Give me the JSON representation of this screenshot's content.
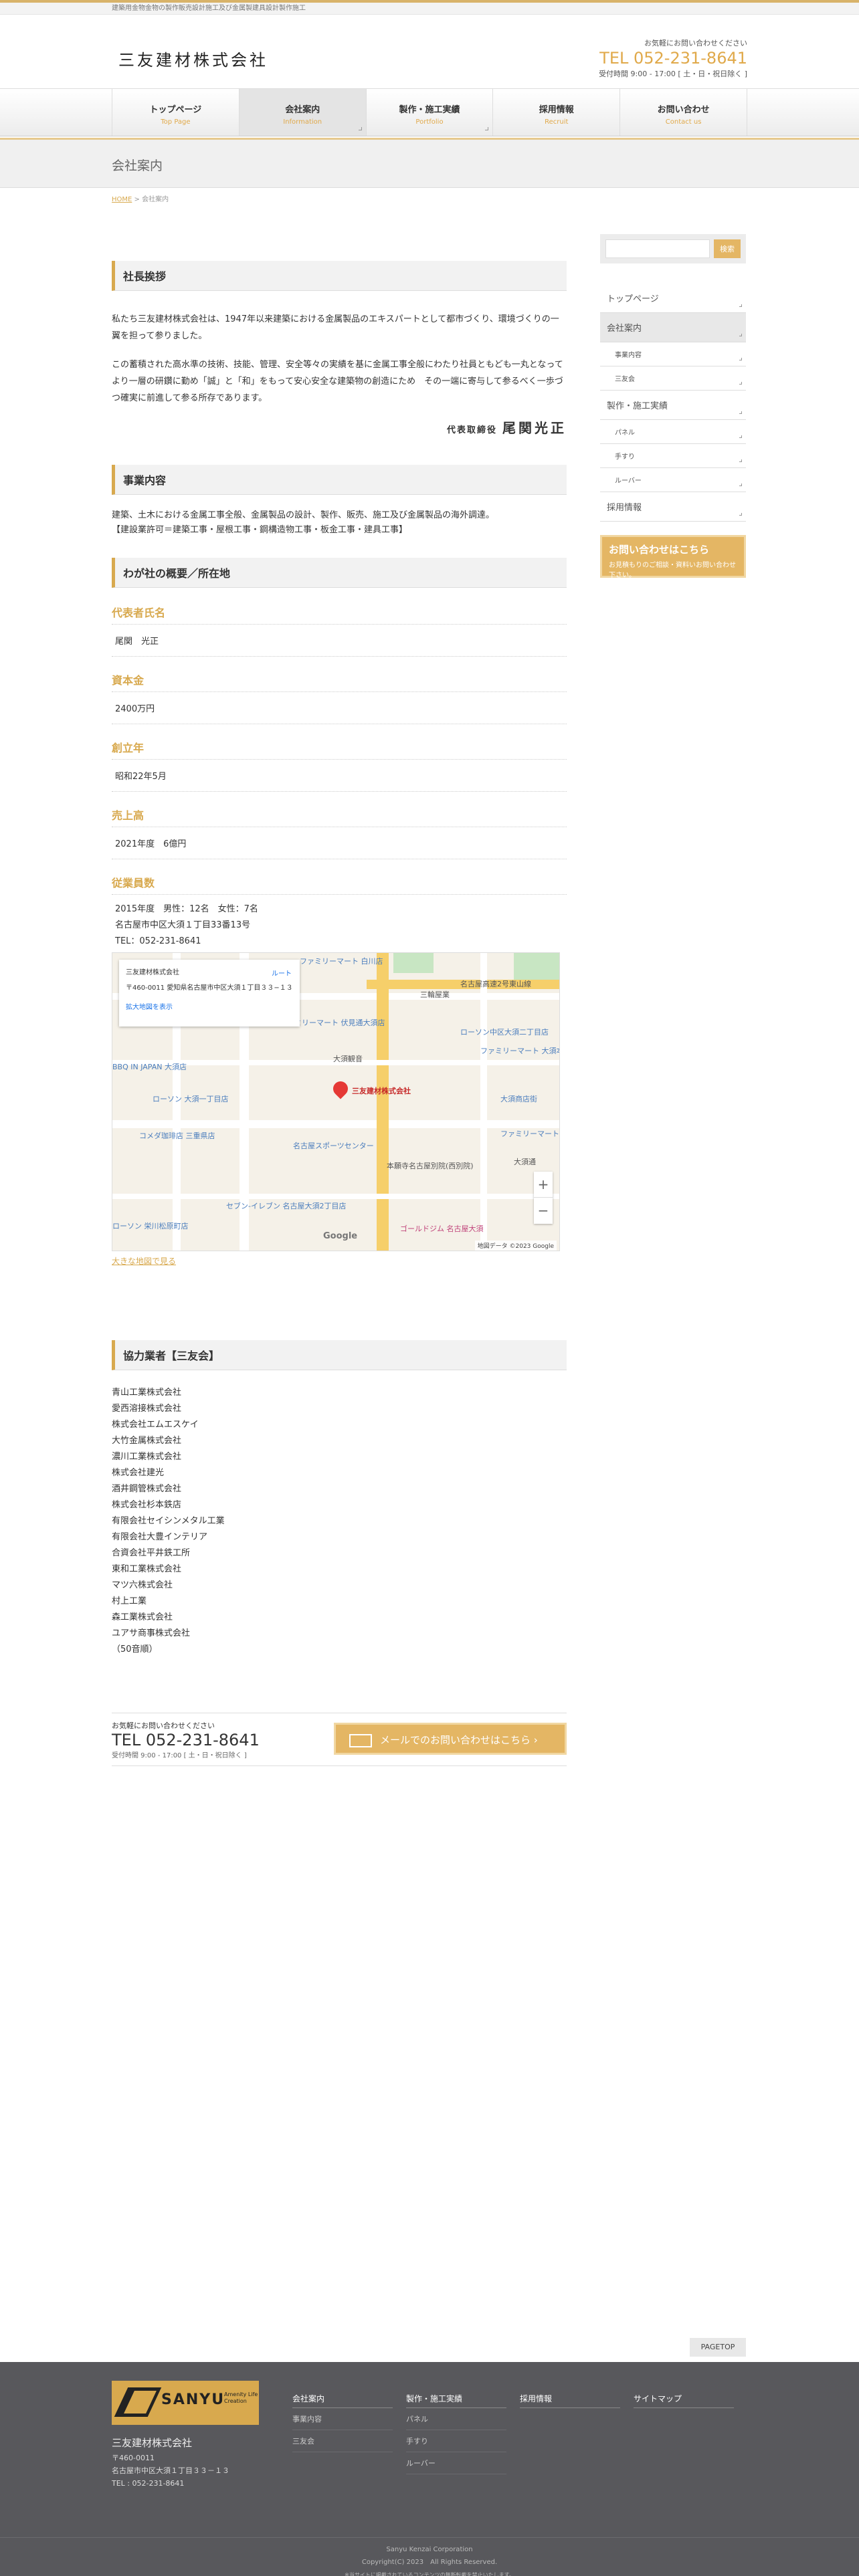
{
  "topbar": {
    "text": "建築用金物金物の製作販売設計施工及び金属製建具設計製作施工"
  },
  "header": {
    "logo": "三友建材株式会社",
    "contact_label": "お気軽にお問い合わせください",
    "tel": "TEL 052-231-8641",
    "hours": "受付時間 9:00 - 17:00 [ 土・日・祝日除く ]"
  },
  "nav": [
    {
      "jp": "トップページ",
      "en": "Top Page"
    },
    {
      "jp": "会社案内",
      "en": "Information"
    },
    {
      "jp": "製作・施工実績",
      "en": "Portfolio"
    },
    {
      "jp": "採用情報",
      "en": "Recruit"
    },
    {
      "jp": "お問い合わせ",
      "en": "Contact us"
    }
  ],
  "page_title": "会社案内",
  "breadcrumb": {
    "home": "HOME",
    "sep": " > ",
    "current": "会社案内"
  },
  "greeting": {
    "heading": "社長挨拶",
    "p1": "私たち三友建材株式会社は、1947年以来建築における金属製品のエキスパートとして都市づくり、環境づくりの一翼を担って参りました。",
    "p2": "この蓄積された高水準の技術、技能、管理、安全等々の実績を基に金属工事全般にわたり社員ともども一丸となってより一層の研鑽に勤め「誠」と「和」をもって安心安全な建築物の創造にため　その一端に寄与して参るべく一歩づつ確実に前進して参る所存であります。",
    "sign_title": "代表取締役",
    "sign_name": "尾関光正"
  },
  "business": {
    "heading": "事業内容",
    "line1": "建築、土木における金属工事全般、金属製品の設計、製作、販売、施工及び金属製品の海外調達。",
    "line2": "【建設業許可＝建築工事・屋根工事・鋼構造物工事・板金工事・建具工事】"
  },
  "overview": {
    "heading": "わが社の概要／所在地",
    "rows": [
      {
        "label": "代表者氏名",
        "value": "尾関　光正"
      },
      {
        "label": "資本金",
        "value": "2400万円"
      },
      {
        "label": "創立年",
        "value": "昭和22年5月"
      },
      {
        "label": "売上高",
        "value": "2021年度　6億円"
      },
      {
        "label": "従業員数",
        "value": ""
      }
    ],
    "employees": "2015年度　男性：12名　女性：7名",
    "address": "名古屋市中区大須１丁目33番13号",
    "tel": "TEL：052-231-8641",
    "biglink": "大きな地図で見る"
  },
  "map": {
    "card_title": "三友建材株式会社",
    "card_addr": "〒460-0011 愛知県名古屋市中区大須１丁目３３−１３",
    "card_link": "拡大地図を表示",
    "card_route": "ルート",
    "marker": "三友建材株式会社",
    "labels": {
      "a": "ファミリーマート 白川店",
      "b": "名古屋高速2号東山線",
      "c": "三輪屋業",
      "d": "ローソン中区大須二丁目店",
      "e": "ファミリーマート 伏見通大須店",
      "f": "大須観音",
      "g": "ファミリーマート 大須本通店",
      "h": "大須商店街",
      "i": "BBQ IN JAPAN 大須店",
      "j": "ローソン 大須一丁目店",
      "k": "コメダ珈琲店 三重県店",
      "l": "名古屋スポーツセンター",
      "m": "ファミリーマート",
      "n": "セブン-イレブン 名古屋大須2丁目店",
      "o": "ローソン 栄川松原町店",
      "p": "ゴールドジム 名古屋大須",
      "q": "大須通",
      "r": "本願寺名古屋別院(西別院)",
      "google": "Google",
      "copy": "地図データ ©2023 Google"
    }
  },
  "partners": {
    "heading": "協力業者【三友会】",
    "list": [
      "青山工業株式会社",
      "愛西溶接株式会社",
      "株式会社エムエスケイ",
      "大竹金属株式会社",
      "濃川工業株式会社",
      "株式会社建光",
      "酒井鋼管株式会社",
      "株式会社杉本鉄店",
      "有限会社セイシンメタル工業",
      "有限会社大豊インテリア",
      "合資会社平井鉄工所",
      "東和工業株式会社",
      "マツ六株式会社",
      "村上工業",
      "森工業株式会社",
      "ユアサ商事株式会社",
      "（50音順）"
    ]
  },
  "contact_box": {
    "label": "お気軽にお問い合わせください",
    "tel": "TEL 052-231-8641",
    "hours": "受付時間 9:00 - 17:00 [ 土・日・祝日除く ]",
    "mail_btn": "メールでのお問い合わせはこちら"
  },
  "sidebar": {
    "search_btn": "検索",
    "menu": [
      {
        "label": "トップページ",
        "sub": false,
        "active": false
      },
      {
        "label": "会社案内",
        "sub": false,
        "active": true
      },
      {
        "label": "事業内容",
        "sub": true,
        "active": false
      },
      {
        "label": "三友会",
        "sub": true,
        "active": false
      },
      {
        "label": "製作・施工実績",
        "sub": false,
        "active": false
      },
      {
        "label": "パネル",
        "sub": true,
        "active": false
      },
      {
        "label": "手すり",
        "sub": true,
        "active": false
      },
      {
        "label": "ルーバー",
        "sub": true,
        "active": false
      },
      {
        "label": "採用情報",
        "sub": false,
        "active": false
      }
    ],
    "contact_title": "お問い合わせはこちら",
    "contact_sub": "お見積もりのご相談・資料いお問い合わせ下さい。"
  },
  "pagetop": "PAGETOP",
  "footer": {
    "logo_word": "SANYU",
    "logo_sub": "Amenity Life Creation",
    "company": "三友建材株式会社",
    "zip": "〒460-0011",
    "address": "名古屋市中区大須１丁目３３－１３",
    "tel": "TEL : 052-231-8641",
    "cols": [
      {
        "head": "会社案内",
        "links": [
          "事業内容",
          "三友会"
        ]
      },
      {
        "head": "製作・施工実績",
        "links": [
          "パネル",
          "手すり",
          "ルーバー"
        ]
      },
      {
        "head": "採用情報",
        "links": []
      },
      {
        "head": "サイトマップ",
        "links": []
      }
    ],
    "corp": "Sanyu Kenzai Corporation",
    "copyright": "Copyright(C) 2023　All Rights Reserved.",
    "small": "※当サイトに掲載されているコンテンツの無断転載を禁止いたします。"
  }
}
